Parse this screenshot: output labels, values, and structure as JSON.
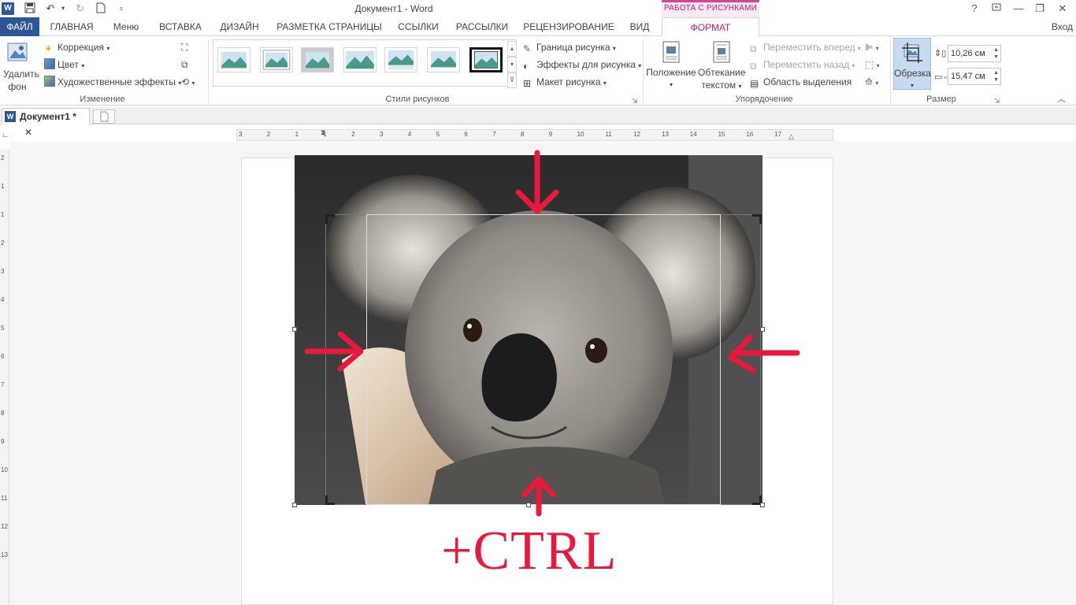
{
  "titlebar": {
    "doc_title": "Документ1 - Word",
    "context_title": "РАБОТА С РИСУНКАМИ",
    "buttons": {
      "help": "?",
      "minimize": "—",
      "restore": "❐",
      "close": "✕"
    }
  },
  "tabs": {
    "file": "ФАЙЛ",
    "home": "ГЛАВНАЯ",
    "menu": "Меню",
    "insert": "ВСТАВКА",
    "design": "ДИЗАЙН",
    "layout": "РАЗМЕТКА СТРАНИЦЫ",
    "references": "ССЫЛКИ",
    "mailings": "РАССЫЛКИ",
    "review": "РЕЦЕНЗИРОВАНИЕ",
    "view": "ВИД",
    "format": "ФОРМАТ",
    "signin": "Вход"
  },
  "ribbon": {
    "adjust": {
      "remove_bg_line1": "Удалить",
      "remove_bg_line2": "фон",
      "correction": "Коррекция",
      "color": "Цвет",
      "artistic": "Художественные эффекты",
      "label": "Изменение"
    },
    "styles": {
      "label": "Стили рисунков",
      "border": "Граница рисунка",
      "effects": "Эффекты для рисунка",
      "layout": "Макет рисунка"
    },
    "arrange": {
      "position": "Положение",
      "wrap_line1": "Обтекание",
      "wrap_line2": "текстом",
      "forward": "Переместить вперед",
      "backward": "Переместить назад",
      "selection": "Область выделения",
      "label": "Упорядочение"
    },
    "size": {
      "crop": "Обрезка",
      "height": "10,26 см",
      "width": "15,47 см",
      "label": "Размер"
    }
  },
  "doc_tab": {
    "name": "Документ1 *",
    "close": "✕"
  },
  "ruler": {
    "h_ticks": [
      "3",
      "2",
      "1",
      "1",
      "2",
      "3",
      "4",
      "5",
      "6",
      "7",
      "8",
      "9",
      "10",
      "11",
      "12",
      "13",
      "14",
      "15",
      "16",
      "17"
    ],
    "v_ticks": [
      "2",
      "1",
      "1",
      "2",
      "3",
      "4",
      "5",
      "6",
      "7",
      "8",
      "9",
      "10",
      "11",
      "12",
      "13"
    ]
  },
  "overlay": {
    "ctrl_text": "+CTRL"
  },
  "colors": {
    "accent": "#2b5797",
    "context": "#c1187d",
    "arrow": "#e8193d"
  }
}
